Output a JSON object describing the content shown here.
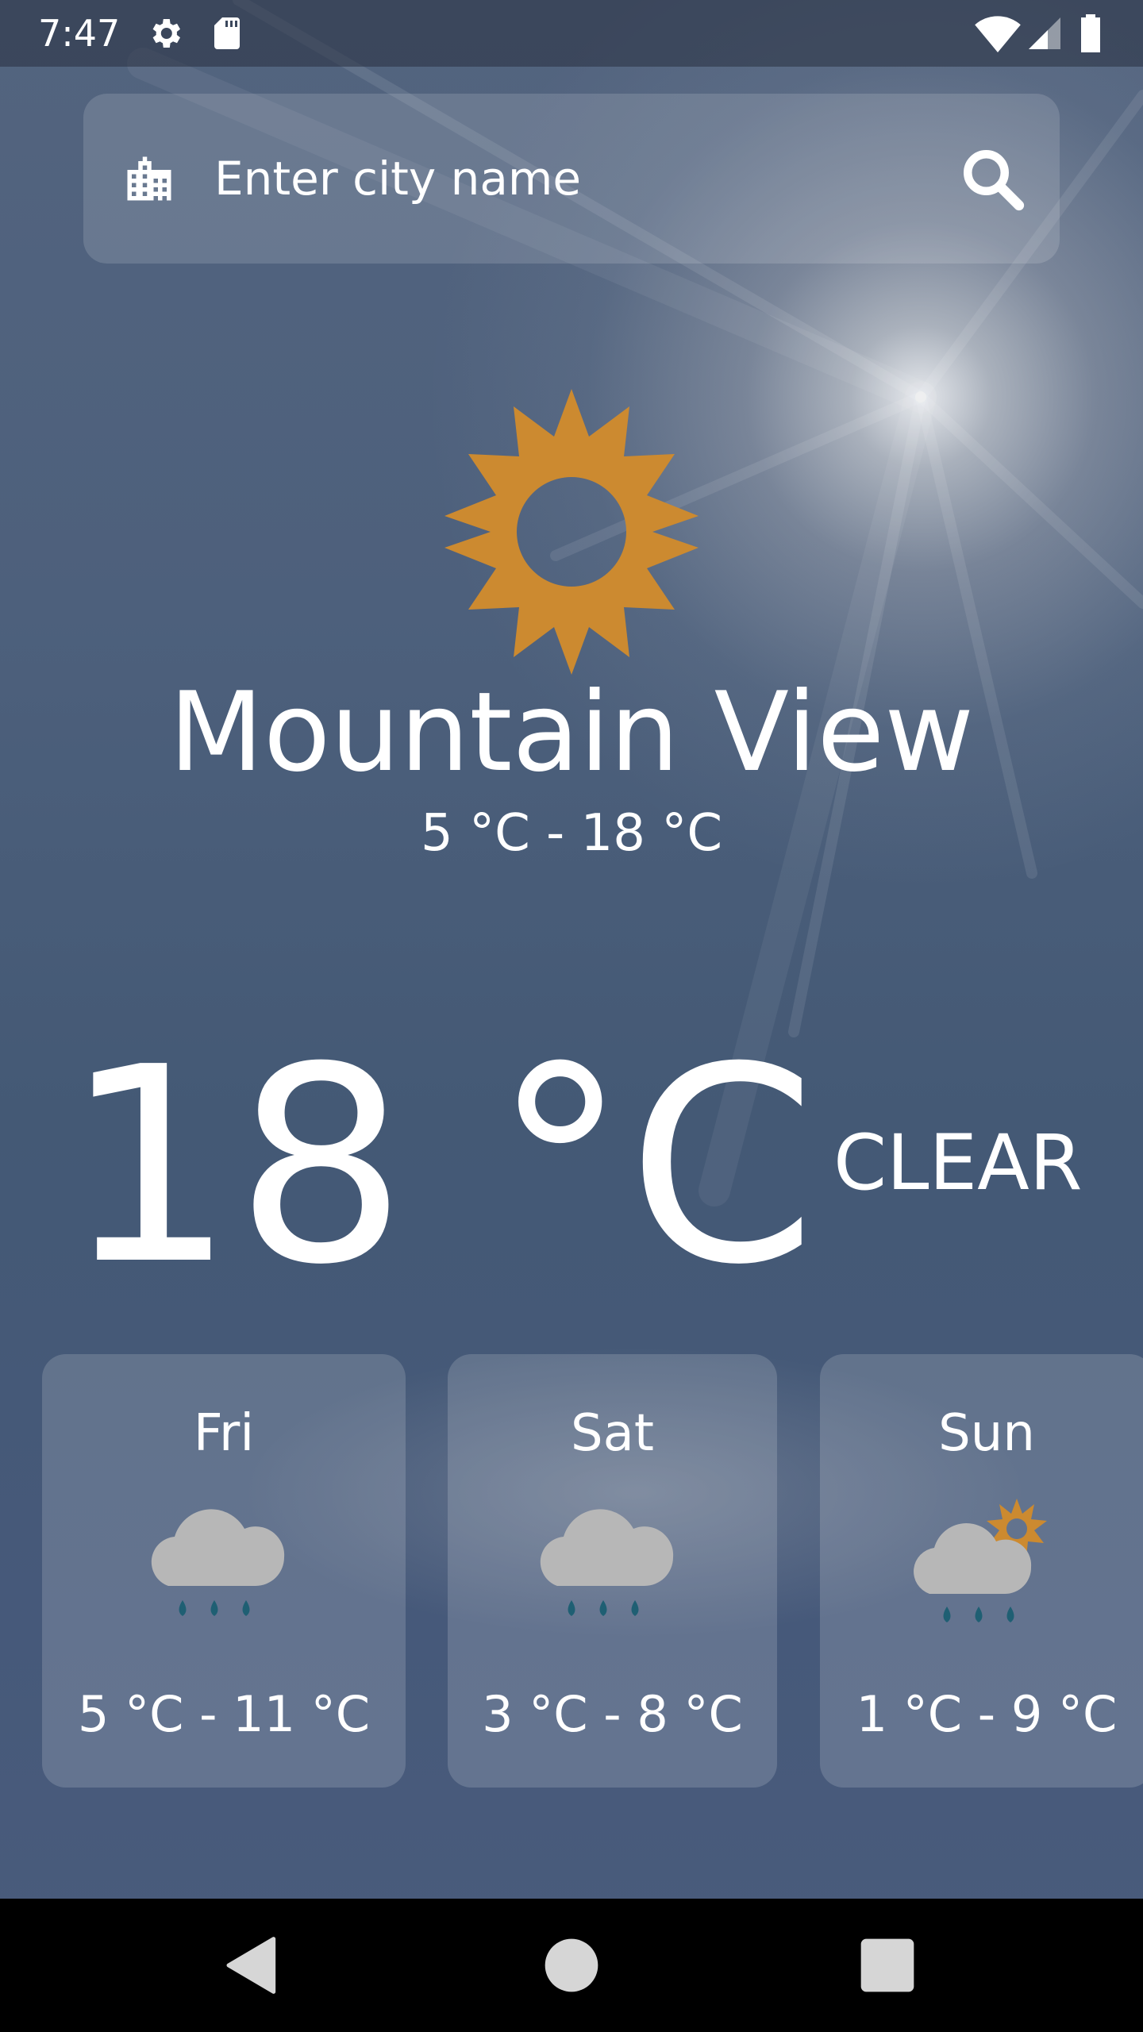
{
  "status_bar": {
    "time": "7:47",
    "icons": [
      "gear-icon",
      "sd-card-icon",
      "wifi-icon",
      "cellular-signal-icon",
      "battery-icon"
    ]
  },
  "search": {
    "placeholder": "Enter city name",
    "value": ""
  },
  "current": {
    "icon": "sun-icon",
    "city": "Mountain View",
    "range": "5 °C - 18 °C",
    "temperature": "18 °C",
    "condition": "CLEAR"
  },
  "forecast": [
    {
      "day": "Fri",
      "icon": "rain-cloud-icon",
      "range": "5 °C - 11 °C"
    },
    {
      "day": "Sat",
      "icon": "rain-cloud-icon",
      "range": "3 °C - 8 °C"
    },
    {
      "day": "Sun",
      "icon": "sun-rain-cloud-icon",
      "range": "1 °C - 9 °C"
    }
  ],
  "nav": {
    "icons": [
      "back-icon",
      "home-icon",
      "recents-icon"
    ]
  },
  "colors": {
    "sun": "#cc8a30",
    "cloud": "#b7b7b7",
    "rain": "#1f5f73",
    "sky": "#4d607c"
  }
}
